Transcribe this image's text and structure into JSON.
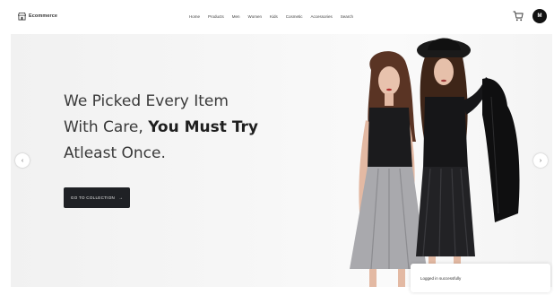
{
  "header": {
    "brand_name": "Ecommerce",
    "brand_icon": "storefront-icon",
    "nav": [
      "Home",
      "Products",
      "Men",
      "Women",
      "Kids",
      "Cosmetic",
      "Accessories",
      "Search"
    ],
    "cart_icon": "cart-icon",
    "avatar_letter": "M"
  },
  "hero": {
    "headline_line1": "We Picked Every Item",
    "headline_line2_regular": "With Care, ",
    "headline_line2_bold": "You Must Try",
    "headline_line3": "Atleast Once.",
    "cta_label": "GO TO COLLECTION",
    "cta_arrow": "→",
    "prev_arrow": "‹",
    "next_arrow": "›"
  },
  "toast": {
    "message": "Logged in successfully"
  },
  "colors": {
    "cta_background": "#1f2125",
    "avatar_background": "#111111",
    "hero_background": "#f4f4f4"
  }
}
